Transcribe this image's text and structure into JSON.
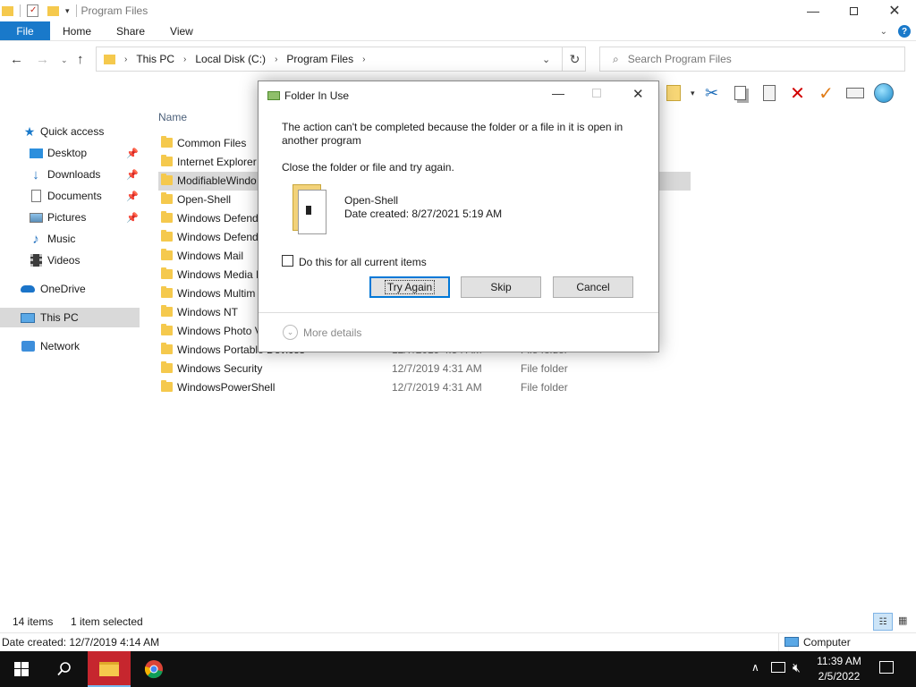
{
  "window": {
    "title": "Program Files"
  },
  "ribbon": {
    "tabs": [
      "File",
      "Home",
      "Share",
      "View"
    ]
  },
  "address": {
    "crumbs": [
      "This PC",
      "Local Disk (C:)",
      "Program Files"
    ],
    "search_placeholder": "Search Program Files"
  },
  "nav": {
    "items": [
      {
        "label": "Quick access",
        "icon": "star-icon"
      },
      {
        "label": "Desktop",
        "icon": "desktop-icon",
        "pinned": true
      },
      {
        "label": "Downloads",
        "icon": "downloads-icon",
        "pinned": true
      },
      {
        "label": "Documents",
        "icon": "documents-icon",
        "pinned": true
      },
      {
        "label": "Pictures",
        "icon": "pictures-icon",
        "pinned": true
      },
      {
        "label": "Music",
        "icon": "music-icon"
      },
      {
        "label": "Videos",
        "icon": "videos-icon"
      },
      {
        "label": "OneDrive",
        "icon": "onedrive-icon"
      },
      {
        "label": "This PC",
        "icon": "pc-icon",
        "selected": true
      },
      {
        "label": "Network",
        "icon": "network-icon"
      }
    ]
  },
  "list": {
    "column_name": "Name",
    "rows": [
      {
        "name": "Common Files",
        "date": "",
        "type": ""
      },
      {
        "name": "Internet Explorer",
        "date": "",
        "type": ""
      },
      {
        "name": "ModifiableWindo",
        "date": "",
        "type": "",
        "selected": true
      },
      {
        "name": "Open-Shell",
        "date": "",
        "type": ""
      },
      {
        "name": "Windows Defend",
        "date": "",
        "type": ""
      },
      {
        "name": "Windows Defend",
        "date": "",
        "type": ""
      },
      {
        "name": "Windows Mail",
        "date": "",
        "type": ""
      },
      {
        "name": "Windows Media I",
        "date": "",
        "type": ""
      },
      {
        "name": "Windows Multim",
        "date": "",
        "type": ""
      },
      {
        "name": "Windows NT",
        "date": "",
        "type": ""
      },
      {
        "name": "Windows Photo V",
        "date": "",
        "type": ""
      },
      {
        "name": "Windows Portable Devices",
        "date": "12/7/2019 4:54 AM",
        "type": "File folder"
      },
      {
        "name": "Windows Security",
        "date": "12/7/2019 4:31 AM",
        "type": "File folder"
      },
      {
        "name": "WindowsPowerShell",
        "date": "12/7/2019 4:31 AM",
        "type": "File folder"
      }
    ]
  },
  "status": {
    "item_count": "14 items",
    "selected_count": "1 item selected",
    "date_created": "Date created: 12/7/2019 4:14 AM",
    "location": "Computer"
  },
  "dialog": {
    "title": "Folder In Use",
    "message": "The action can't be completed because the folder or a file in it is open in another program",
    "instruction": "Close the folder or file and try again.",
    "item_name": "Open-Shell",
    "item_date": "Date created: 8/27/2021 5:19 AM",
    "checkbox_label": "Do this for all current items",
    "buttons": {
      "try_again": "Try Again",
      "skip": "Skip",
      "cancel": "Cancel"
    },
    "more_details": "More details"
  },
  "taskbar": {
    "time": "11:39 AM",
    "date": "2/5/2022"
  },
  "colors": {
    "file_tab": "#1979ca",
    "folder": "#f5c94d",
    "selection": "#d9d9d9",
    "taskbar": "#101010"
  }
}
